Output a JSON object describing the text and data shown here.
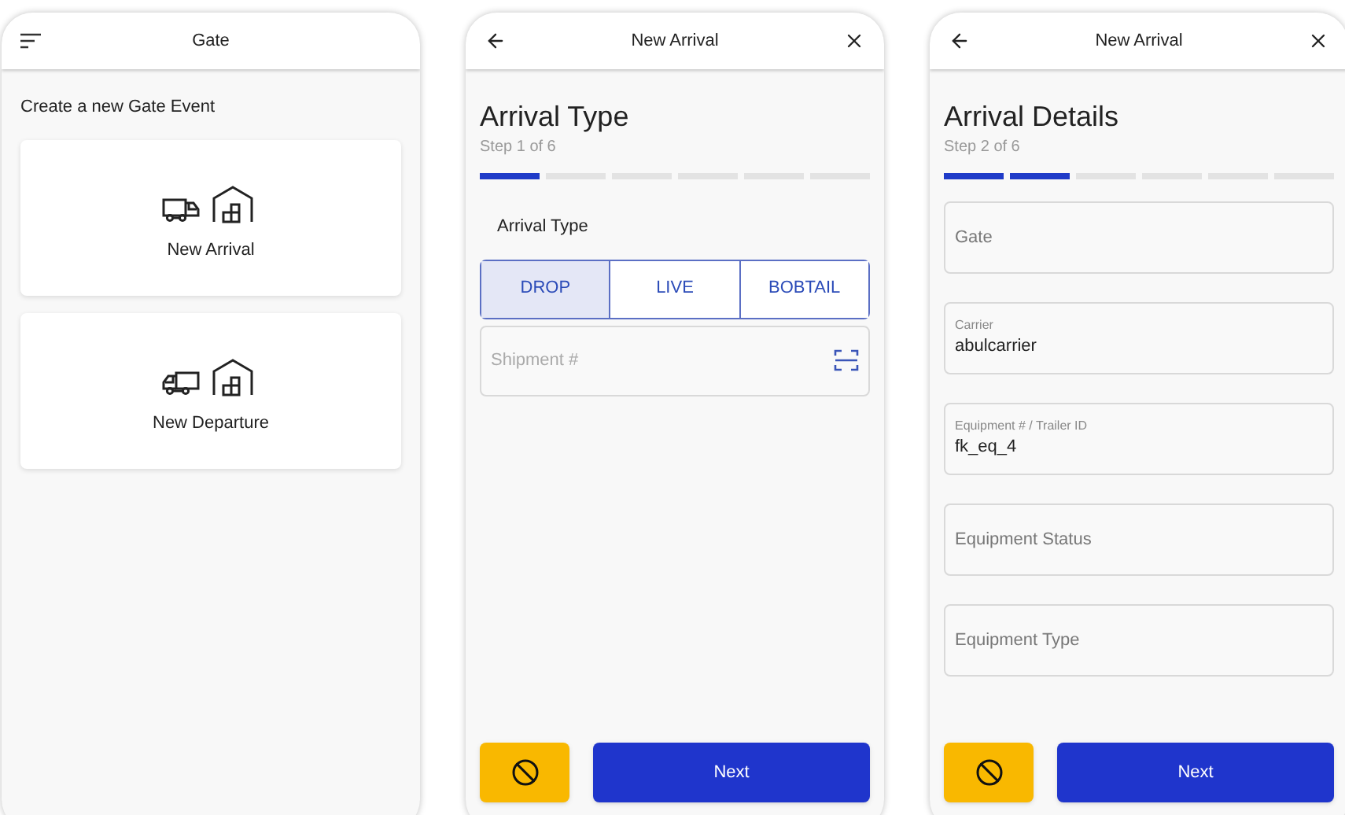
{
  "screens": [
    {
      "kind": "menu",
      "header": {
        "title": "Gate"
      },
      "intro": "Create a new Gate Event",
      "cards": [
        {
          "label": "New Arrival",
          "kind": "arrival"
        },
        {
          "label": "New Departure",
          "kind": "departure"
        }
      ]
    },
    {
      "kind": "wizard",
      "header": {
        "title": "New Arrival"
      },
      "heading": "Arrival Type",
      "step": "Step 1 of 6",
      "progress": [
        {
          "complete": true
        },
        {
          "complete": false
        },
        {
          "complete": false
        },
        {
          "complete": false
        },
        {
          "complete": false
        },
        {
          "complete": false
        }
      ],
      "fields": [
        {
          "kind": "segmented",
          "label": "Arrival Type",
          "options": [
            {
              "label": "DROP",
              "selected": true
            },
            {
              "label": "LIVE",
              "selected": false
            },
            {
              "label": "BOBTAIL",
              "selected": false
            }
          ]
        },
        {
          "kind": "scan",
          "placeholder": "Shipment #"
        }
      ],
      "next": "Next"
    },
    {
      "kind": "wizard",
      "header": {
        "title": "New Arrival"
      },
      "heading": "Arrival Details",
      "step": "Step 2 of 6",
      "progress": [
        {
          "complete": true
        },
        {
          "complete": true
        },
        {
          "complete": false
        },
        {
          "complete": false
        },
        {
          "complete": false
        },
        {
          "complete": false
        }
      ],
      "fields": [
        {
          "kind": "text",
          "placeholder": "Gate"
        },
        {
          "kind": "text",
          "label": "Carrier",
          "value": "abulcarrier"
        },
        {
          "kind": "text",
          "label": "Equipment # / Trailer ID",
          "value": "fk_eq_4"
        },
        {
          "kind": "text",
          "placeholder": "Equipment Status"
        },
        {
          "kind": "text",
          "placeholder": "Equipment Type"
        }
      ],
      "next": "Next"
    }
  ]
}
